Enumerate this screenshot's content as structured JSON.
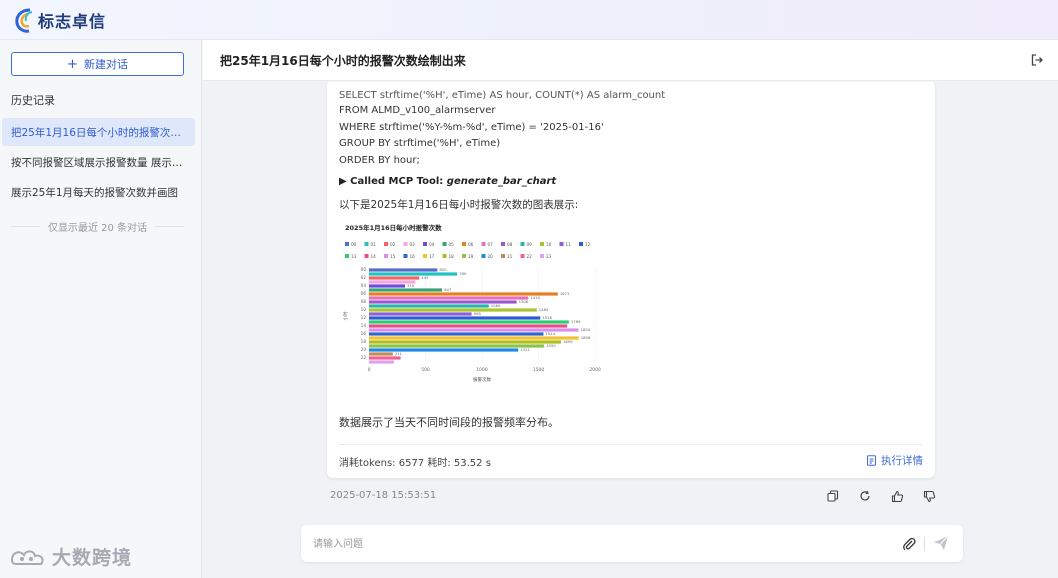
{
  "app": {
    "logo_text": "标志卓信"
  },
  "sidebar": {
    "new_chat_label": "新建对话",
    "history_title": "历史记录",
    "items": [
      {
        "label": "把25年1月16日每个小时的报警次…",
        "active": true
      },
      {
        "label": "按不同报警区域展示报警数量 展示…",
        "active": false
      },
      {
        "label": "展示25年1月每天的报警次数并画图",
        "active": false
      }
    ],
    "recent_note": "仅显示最近 20 条对话"
  },
  "watermark": {
    "text": "大数跨境"
  },
  "header": {
    "title": "把25年1月16日每个小时的报警次数绘制出来"
  },
  "message": {
    "code_lines": [
      "SELECT strftime('%H', eTime) AS hour, COUNT(*) AS alarm_count",
      "FROM ALMD_v100_alarmserver",
      "WHERE strftime('%Y-%m-%d', eTime) = '2025-01-16'",
      "GROUP BY strftime('%H', eTime)",
      "ORDER BY hour;"
    ],
    "mcp_prefix": "▶ Called MCP Tool: ",
    "mcp_tool": "generate_bar_chart",
    "chart_intro": "以下是2025年1月16日每小时报警次数的图表展示:",
    "summary": "数据展示了当天不同时间段的报警频率分布。",
    "stats": "消耗tokens: 6577  耗时: 53.52 s",
    "exec_detail": "执行详情",
    "timestamp": "2025-07-18 15:53:51"
  },
  "input": {
    "placeholder": "请输入问题"
  },
  "colors": {
    "accent": "#3d6ce0",
    "active_bg": "#dfe8fb"
  },
  "chart_data": {
    "type": "bar",
    "orientation": "horizontal",
    "title": "2025年1月16日每小时报警次数",
    "xlabel": "报警次数",
    "ylabel": "小时",
    "xlim": [
      0,
      2000
    ],
    "xticks": [
      0,
      500,
      1000,
      1500,
      2000
    ],
    "legend_position": "top",
    "categories": [
      "00",
      "01",
      "02",
      "03",
      "04",
      "05",
      "06",
      "07",
      "08",
      "09",
      "10",
      "11",
      "12",
      "13",
      "14",
      "15",
      "16",
      "17",
      "18",
      "19",
      "20",
      "21",
      "22",
      "23"
    ],
    "y_tick_labels": [
      "00",
      "02",
      "04",
      "06",
      "08",
      "10",
      "12",
      "14",
      "16",
      "18",
      "20",
      "22"
    ],
    "values": [
      605,
      780,
      445,
      410,
      319,
      647,
      1671,
      1410,
      1306,
      1060,
      1485,
      908,
      1516,
      1769,
      1754,
      1854,
      1544,
      1856,
      1699,
      1550,
      1321,
      211,
      280,
      220
    ],
    "data_labels": [
      "605",
      "780",
      "445",
      "",
      "319",
      "647",
      "1671",
      "1410",
      "1306",
      "1060",
      "1485",
      "908",
      "1516",
      "1769",
      "",
      "1854",
      "1544",
      "1856",
      "1699",
      "1550",
      "1321",
      "211",
      "",
      ""
    ],
    "colors": [
      "#5470c6",
      "#22c1c3",
      "#ee6666",
      "#f7a6e0",
      "#6b4ce0",
      "#3ba272",
      "#e67e22",
      "#e66fb7",
      "#9b59d0",
      "#2ab7a9",
      "#a6c62f",
      "#8e5fd6",
      "#2f5bd3",
      "#2ecc71",
      "#e74c8c",
      "#d98ee8",
      "#3366cc",
      "#f2c12e",
      "#b0bf1a",
      "#8bc34a",
      "#1e88e5",
      "#c48b5a",
      "#f06292",
      "#e0a0f0"
    ]
  }
}
